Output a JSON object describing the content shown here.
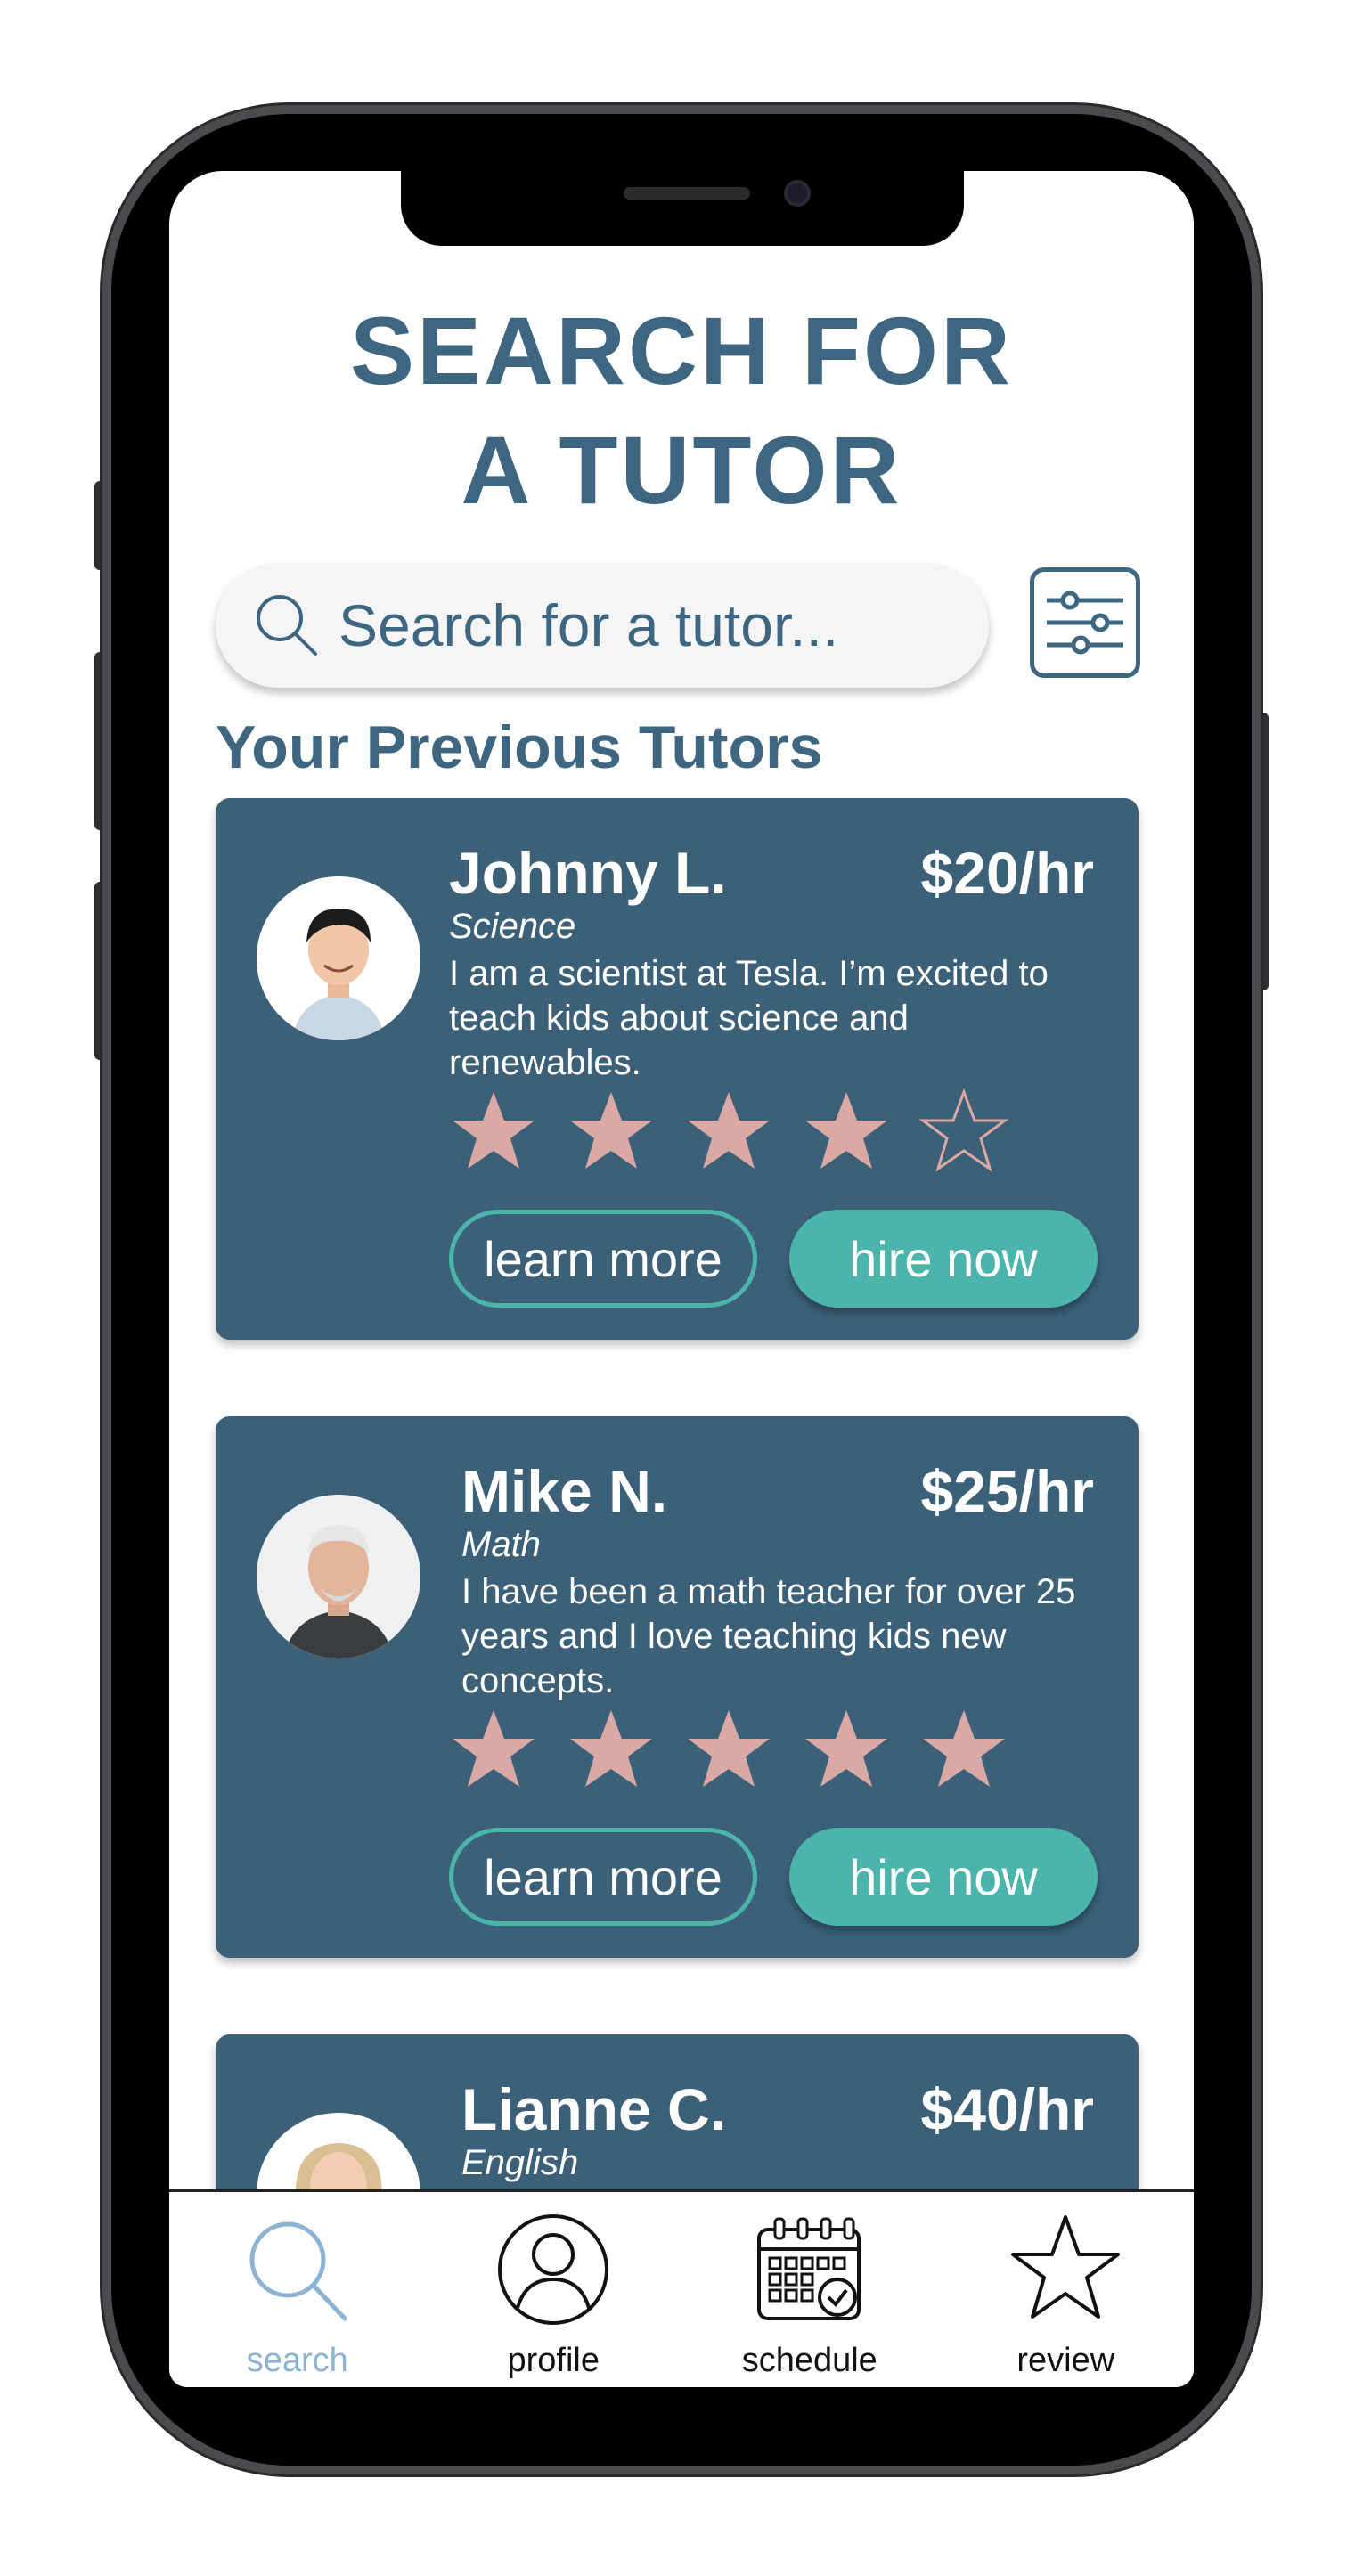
{
  "page": {
    "title_line1": "SEARCH FOR",
    "title_line2": "A TUTOR"
  },
  "search": {
    "placeholder": "Search for a tutor...",
    "icon": "search-icon"
  },
  "filter": {
    "icon": "sliders-icon"
  },
  "section": {
    "heading": "Your Previous Tutors"
  },
  "tutors": [
    {
      "name": "Johnny L.",
      "rate": "$20/hr",
      "subject": "Science",
      "bio": "I am a scientist at Tesla. I’m excited to teach kids about science and renewables.",
      "rating": 4,
      "rating_max": 5,
      "learn_more": "learn more",
      "hire_now": "hire now"
    },
    {
      "name": "Mike N.",
      "rate": "$25/hr",
      "subject": "Math",
      "bio": "I have been a math teacher for over 25 years and I love teaching kids new concepts.",
      "rating": 5,
      "rating_max": 5,
      "learn_more": "learn more",
      "hire_now": "hire now"
    },
    {
      "name": "Lianne C.",
      "rate": "$40/hr",
      "subject": "English"
    }
  ],
  "nav": {
    "items": [
      {
        "label": "search",
        "icon": "search-icon",
        "active": true
      },
      {
        "label": "profile",
        "icon": "user-icon",
        "active": false
      },
      {
        "label": "schedule",
        "icon": "calendar-icon",
        "active": false
      },
      {
        "label": "review",
        "icon": "star-icon",
        "active": false
      }
    ]
  },
  "colors": {
    "primary": "#3e6680",
    "card": "#3b6078",
    "accent": "#4bb5ac",
    "star": "#dba9a5",
    "nav_active": "#8bb3d2"
  }
}
